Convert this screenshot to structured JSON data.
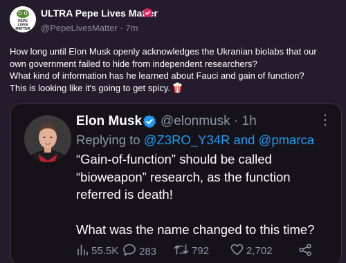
{
  "post": {
    "author_name": "ULTRA Pepe Lives Matter",
    "handle": "@PepeLivesMatter",
    "separator": "·",
    "time": "7m",
    "avatar_text": [
      "PEPE",
      "LIVES",
      "MATTER"
    ],
    "body_lines": [
      "How long until Elon Musk openly acknowledges the Ukranian biolabs that our",
      "own government failed to hide from independent researchers?",
      "What kind of information has he learned about Fauci and gain of function?",
      "This is looking like it's going to get spicy."
    ],
    "body_emoji": "popcorn-icon"
  },
  "quote": {
    "author_name": "Elon Musk",
    "handle": "@elonmusk",
    "separator": "·",
    "time": "1h",
    "more_glyph": "⋮",
    "replying_prefix": "Replying to ",
    "replying_mention_1": "@Z3RO_Y34R",
    "replying_and": " and ",
    "replying_mention_2": "@pmarca",
    "text_lines": [
      "“Gain-of-function” should be called",
      "“bioweapon” research, as the function",
      "referred is death!",
      "",
      "What was the name changed to this time?"
    ],
    "stats": {
      "views": "55.5K",
      "replies": "283",
      "retweets": "792",
      "likes": "2,702"
    }
  },
  "colors": {
    "background": "#241c2c",
    "card": "#15121a",
    "muted": "#8b98a5",
    "link": "#1d9bf0",
    "verified_blue": "#1d9bf0",
    "verified_pink": "#e0245e"
  }
}
